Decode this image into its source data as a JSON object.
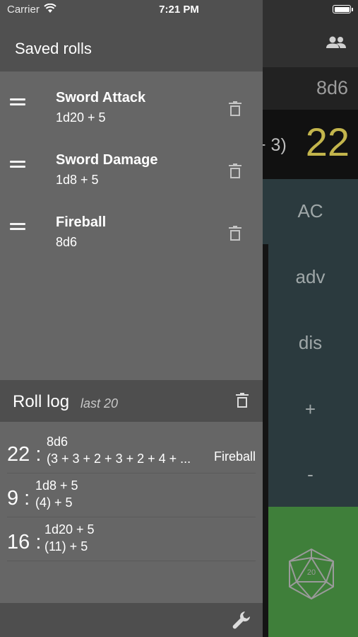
{
  "status_bar": {
    "carrier": "Carrier",
    "time": "7:21 PM"
  },
  "background": {
    "expression": "8d6",
    "partial_result": "+ 3)",
    "total": "22",
    "keys": [
      "AC",
      "adv",
      "dis",
      "+",
      "-"
    ],
    "dice_icon_label": "20",
    "colors": {
      "result": "#c3b54c",
      "keypad": "#2b3a3e",
      "roll_button": "#3f7f3a"
    }
  },
  "drawer": {
    "title": "Saved rolls",
    "saved_rolls": [
      {
        "name": "Sword Attack",
        "expression": "1d20 + 5"
      },
      {
        "name": "Sword Damage",
        "expression": "1d8 + 5"
      },
      {
        "name": "Fireball",
        "expression": "8d6"
      }
    ],
    "log": {
      "title": "Roll log",
      "subtitle": "last 20",
      "entries": [
        {
          "total": "22 :",
          "expression": "8d6",
          "breakdown": "(3 + 3 + 2 + 3 + 2 + 4 + ...",
          "name": "Fireball"
        },
        {
          "total": "9 :",
          "expression": "1d8 + 5",
          "breakdown": "(4) + 5",
          "name": ""
        },
        {
          "total": "16 :",
          "expression": "1d20 + 5",
          "breakdown": "(11) + 5",
          "name": ""
        }
      ]
    },
    "icons": {
      "drag": "drag-handle-icon",
      "delete": "trash-icon",
      "settings": "wrench-icon",
      "group": "group-icon"
    }
  }
}
